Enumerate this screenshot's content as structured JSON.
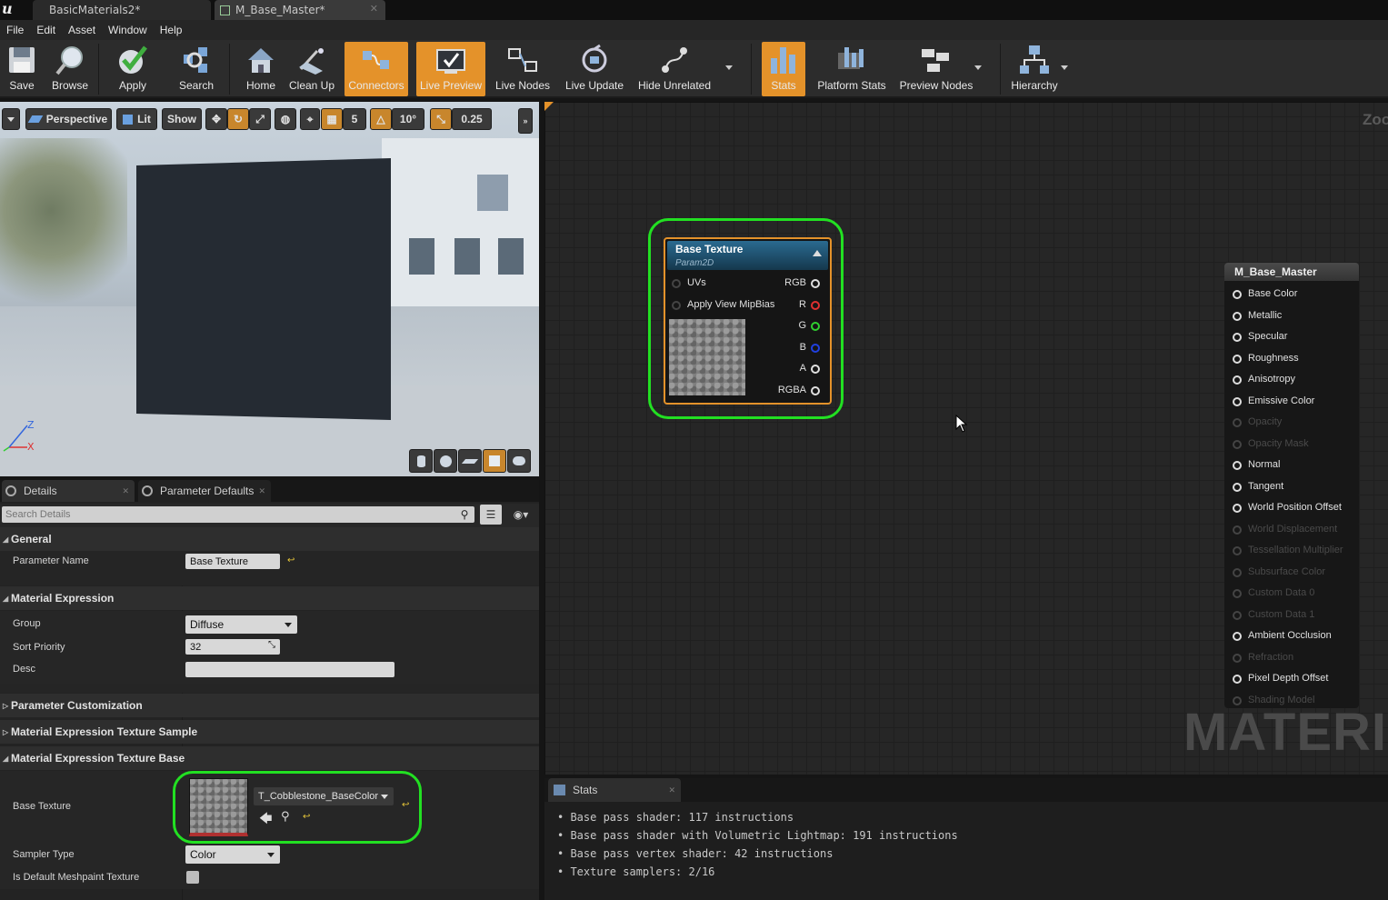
{
  "titlebar": {
    "tabs": [
      {
        "label": "BasicMaterials2*",
        "active": false
      },
      {
        "label": "M_Base_Master*",
        "active": true
      }
    ],
    "close_glyph": "✕"
  },
  "menu": [
    "File",
    "Edit",
    "Asset",
    "Window",
    "Help"
  ],
  "toolbar": {
    "buttons": [
      {
        "label": "Save",
        "icon": "save-icon"
      },
      {
        "label": "Browse",
        "icon": "browse-icon"
      },
      {
        "label": "Apply",
        "icon": "apply-icon"
      },
      {
        "label": "Search",
        "icon": "search-icon"
      },
      {
        "label": "Home",
        "icon": "home-icon"
      },
      {
        "label": "Clean Up",
        "icon": "clean-up-icon"
      },
      {
        "label": "Connectors",
        "icon": "connectors-icon",
        "active": true
      },
      {
        "label": "Live Preview",
        "icon": "live-preview-icon",
        "active": true
      },
      {
        "label": "Live Nodes",
        "icon": "live-nodes-icon"
      },
      {
        "label": "Live Update",
        "icon": "live-update-icon"
      },
      {
        "label": "Hide Unrelated",
        "icon": "hide-unrelated-icon"
      },
      {
        "label": "Stats",
        "icon": "stats-icon",
        "active": true
      },
      {
        "label": "Platform Stats",
        "icon": "platform-stats-icon"
      },
      {
        "label": "Preview Nodes",
        "icon": "preview-nodes-icon"
      },
      {
        "label": "Hierarchy",
        "icon": "hierarchy-icon"
      }
    ],
    "accent_color": "#e4922a"
  },
  "viewport": {
    "perspective_label": "Perspective",
    "lit_label": "Lit",
    "show_label": "Show",
    "grid_snap": "5",
    "rotation_snap": "10°",
    "scale_snap": "0.25",
    "axis_z": "Z",
    "axis_x": "X"
  },
  "details": {
    "tabs": [
      {
        "label": "Details"
      },
      {
        "label": "Parameter Defaults"
      }
    ],
    "search_placeholder": "Search Details",
    "categories": {
      "general": "General",
      "material_expression": "Material Expression",
      "param_customization": "Parameter Customization",
      "texture_sample": "Material Expression Texture Sample",
      "texture_base": "Material Expression Texture Base"
    },
    "props": {
      "parameter_name_label": "Parameter Name",
      "parameter_name_value": "Base Texture",
      "group_label": "Group",
      "group_value": "Diffuse",
      "sort_priority_label": "Sort Priority",
      "sort_priority_value": "32",
      "desc_label": "Desc",
      "desc_value": "",
      "base_texture_label": "Base Texture",
      "base_texture_value": "T_Cobblestone_BaseColor",
      "sampler_type_label": "Sampler Type",
      "sampler_type_value": "Color",
      "default_meshpaint_label": "Is Default Meshpaint Texture",
      "default_meshpaint_checked": false
    },
    "reset_glyph": "↩"
  },
  "graph": {
    "zoom_label": "Zoo",
    "watermark": "MATERIA",
    "param_node": {
      "title": "Base Texture",
      "subtitle": "Param2D",
      "inputs": [
        "UVs",
        "Apply View MipBias"
      ],
      "outputs": [
        {
          "label": "RGB",
          "color": "#e0e0e0"
        },
        {
          "label": "R",
          "color": "#e03030"
        },
        {
          "label": "G",
          "color": "#30d030"
        },
        {
          "label": "B",
          "color": "#2040e0"
        },
        {
          "label": "A",
          "color": "#e0e0e0"
        },
        {
          "label": "RGBA",
          "color": "#e0e0e0"
        }
      ]
    },
    "result_node": {
      "title": "M_Base_Master",
      "pins": [
        {
          "label": "Base Color",
          "enabled": true
        },
        {
          "label": "Metallic",
          "enabled": true
        },
        {
          "label": "Specular",
          "enabled": true
        },
        {
          "label": "Roughness",
          "enabled": true
        },
        {
          "label": "Anisotropy",
          "enabled": true
        },
        {
          "label": "Emissive Color",
          "enabled": true
        },
        {
          "label": "Opacity",
          "enabled": false
        },
        {
          "label": "Opacity Mask",
          "enabled": false
        },
        {
          "label": "Normal",
          "enabled": true
        },
        {
          "label": "Tangent",
          "enabled": true
        },
        {
          "label": "World Position Offset",
          "enabled": true
        },
        {
          "label": "World Displacement",
          "enabled": false
        },
        {
          "label": "Tessellation Multiplier",
          "enabled": false
        },
        {
          "label": "Subsurface Color",
          "enabled": false
        },
        {
          "label": "Custom Data 0",
          "enabled": false
        },
        {
          "label": "Custom Data 1",
          "enabled": false
        },
        {
          "label": "Ambient Occlusion",
          "enabled": true
        },
        {
          "label": "Refraction",
          "enabled": false
        },
        {
          "label": "Pixel Depth Offset",
          "enabled": true
        },
        {
          "label": "Shading Model",
          "enabled": false
        }
      ]
    }
  },
  "stats": {
    "tab_label": "Stats",
    "lines": [
      "Base pass shader: 117 instructions",
      "Base pass shader with Volumetric Lightmap: 191 instructions",
      "Base pass vertex shader: 42 instructions",
      "Texture samplers: 2/16"
    ]
  },
  "highlight_color": "#22e022"
}
